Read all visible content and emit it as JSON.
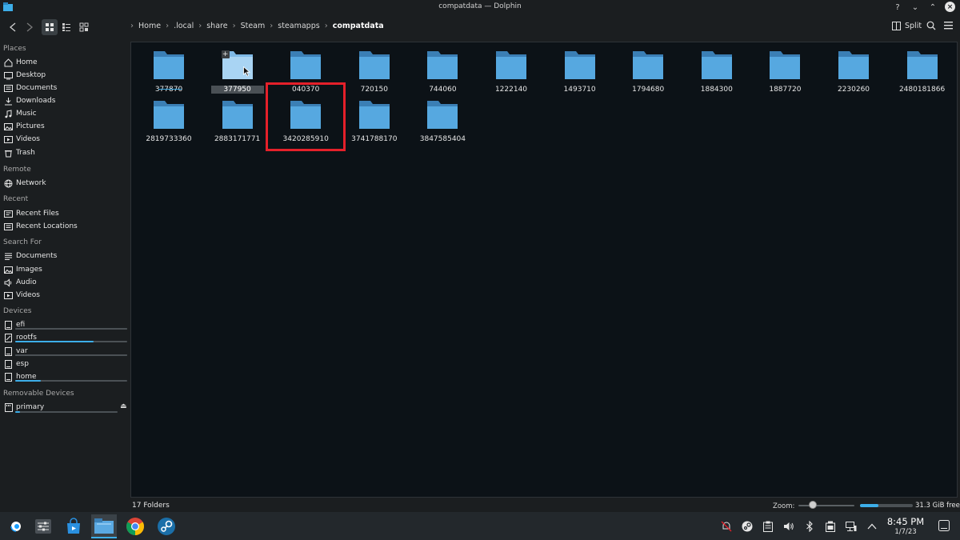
{
  "window": {
    "title": "compatdata — Dolphin"
  },
  "toolbar": {
    "split_label": "Split"
  },
  "breadcrumb": [
    "Home",
    ".local",
    "share",
    "Steam",
    "steamapps",
    "compatdata"
  ],
  "sidebar": {
    "places_label": "Places",
    "places": [
      {
        "label": "Home",
        "icon": "home-icon"
      },
      {
        "label": "Desktop",
        "icon": "desktop-icon"
      },
      {
        "label": "Documents",
        "icon": "documents-icon"
      },
      {
        "label": "Downloads",
        "icon": "downloads-icon"
      },
      {
        "label": "Music",
        "icon": "music-icon"
      },
      {
        "label": "Pictures",
        "icon": "pictures-icon"
      },
      {
        "label": "Videos",
        "icon": "videos-icon"
      },
      {
        "label": "Trash",
        "icon": "trash-icon"
      }
    ],
    "remote_label": "Remote",
    "remote": [
      {
        "label": "Network",
        "icon": "network-icon"
      }
    ],
    "recent_label": "Recent",
    "recent": [
      {
        "label": "Recent Files",
        "icon": "recent-files-icon"
      },
      {
        "label": "Recent Locations",
        "icon": "recent-locations-icon"
      }
    ],
    "search_label": "Search For",
    "search": [
      {
        "label": "Documents",
        "icon": "documents-icon"
      },
      {
        "label": "Images",
        "icon": "images-icon"
      },
      {
        "label": "Audio",
        "icon": "audio-icon"
      },
      {
        "label": "Videos",
        "icon": "videos-icon"
      }
    ],
    "devices_label": "Devices",
    "devices": [
      {
        "label": "efi",
        "usage": 1.0
      },
      {
        "label": "rootfs",
        "usage": 0.7
      },
      {
        "label": "var",
        "usage": 1.0
      },
      {
        "label": "esp",
        "usage": 1.0
      },
      {
        "label": "home",
        "usage": 0.23
      }
    ],
    "removable_label": "Removable Devices",
    "removable": [
      {
        "label": "primary",
        "usage": 0.05
      }
    ]
  },
  "folders": [
    "377870",
    "377950",
    "040370",
    "720150",
    "744060",
    "1222140",
    "1493710",
    "1794680",
    "1884300",
    "1887720",
    "2230260",
    "2480181866",
    "2819733360",
    "2883171771",
    "3420285910",
    "3741788170",
    "3847585404"
  ],
  "colors": {
    "accent": "#3daee9",
    "highlight_box": "#e5202a",
    "folder": "#56a8e0",
    "folder_tab": "#3b7fb5"
  },
  "status": {
    "folder_count": "17 Folders",
    "zoom_label": "Zoom:",
    "free_space": "31.3 GiB free",
    "free_usage": 0.35
  },
  "taskbar": {
    "time": "8:45 PM",
    "date": "1/7/23"
  }
}
